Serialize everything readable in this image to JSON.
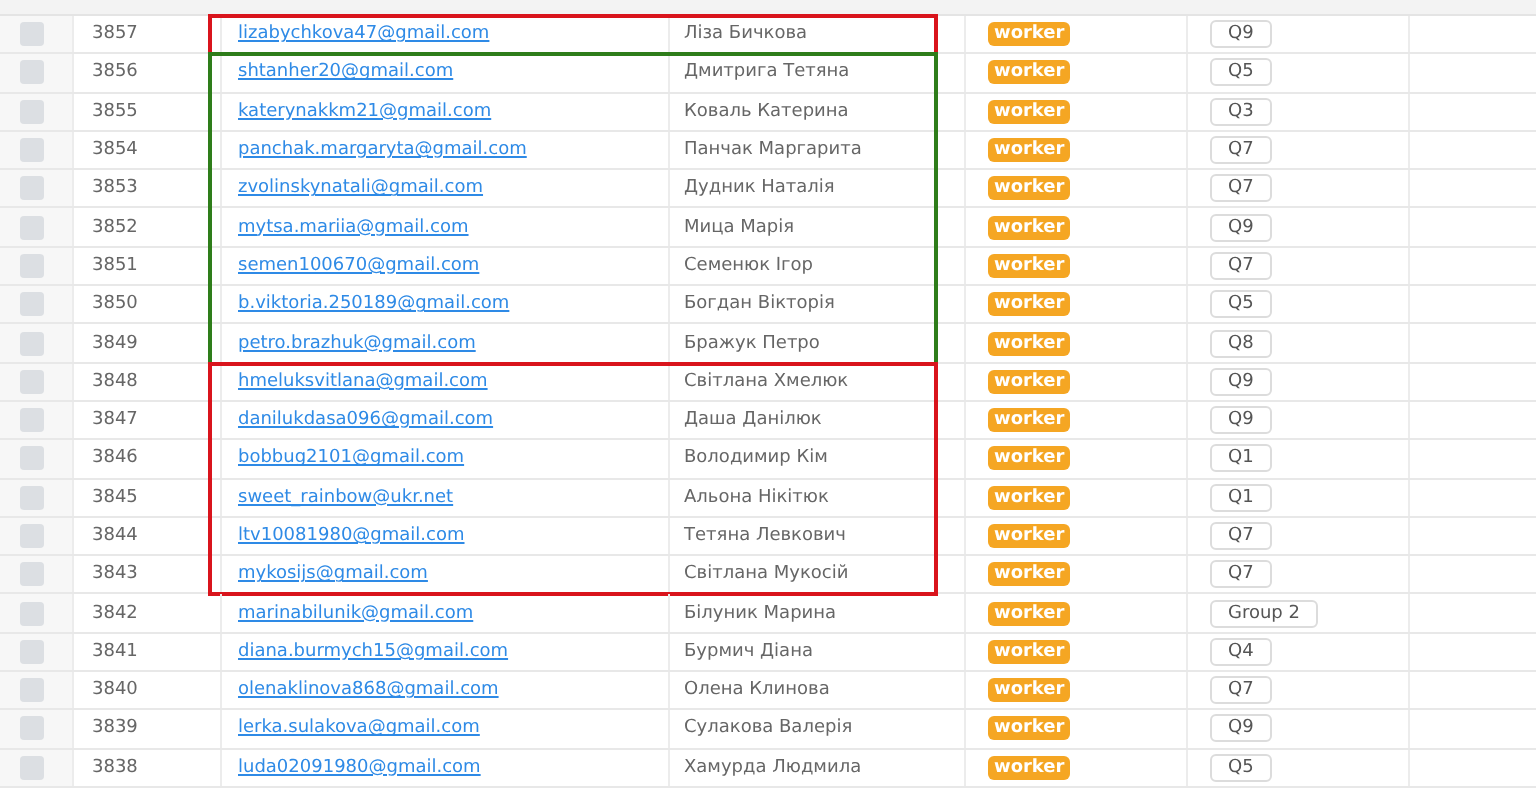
{
  "row_groups": [
    {
      "color": "#d9141c",
      "rows": [
        {
          "checked": false,
          "id": "3857",
          "email": "lizabychkova47@gmail.com",
          "name": "Ліза Бичкова",
          "role": "worker",
          "group": "Q9"
        }
      ]
    },
    {
      "color": "#2e7d1a",
      "rows": [
        {
          "checked": false,
          "id": "3856",
          "email": "shtanher20@gmail.com",
          "name": "Дмитрига Тетяна",
          "role": "worker",
          "group": "Q5"
        },
        {
          "checked": false,
          "id": "3855",
          "email": "katerynakkm21@gmail.com",
          "name": "Коваль Катерина",
          "role": "worker",
          "group": "Q3"
        },
        {
          "checked": false,
          "id": "3854",
          "email": "panchak.margaryta@gmail.com",
          "name": "Панчак Маргарита",
          "role": "worker",
          "group": "Q7"
        },
        {
          "checked": false,
          "id": "3853",
          "email": "zvolinskynatali@gmail.com",
          "name": "Дудник Наталія",
          "role": "worker",
          "group": "Q7"
        },
        {
          "checked": false,
          "id": "3852",
          "email": "mytsa.mariia@gmail.com",
          "name": "Мица Марія",
          "role": "worker",
          "group": "Q9"
        },
        {
          "checked": false,
          "id": "3851",
          "email": "semen100670@gmail.com",
          "name": "Семенюк Ігор",
          "role": "worker",
          "group": "Q7"
        },
        {
          "checked": false,
          "id": "3850",
          "email": "b.viktoria.250189@gmail.com",
          "name": "Богдан Вікторія",
          "role": "worker",
          "group": "Q5"
        },
        {
          "checked": false,
          "id": "3849",
          "email": "petro.brazhuk@gmail.com",
          "name": "Бражук Петро",
          "role": "worker",
          "group": "Q8"
        }
      ]
    },
    {
      "color": "#d9141c",
      "rows": [
        {
          "checked": false,
          "id": "3848",
          "email": "hmeluksvitlana@gmail.com",
          "name": "Світлана Хмелюк",
          "role": "worker",
          "group": "Q9"
        },
        {
          "checked": false,
          "id": "3847",
          "email": "danilukdasa096@gmail.com",
          "name": "Даша Данілюк",
          "role": "worker",
          "group": "Q9"
        },
        {
          "checked": false,
          "id": "3846",
          "email": "bobbug2101@gmail.com",
          "name": "Володимир Кім",
          "role": "worker",
          "group": "Q1"
        },
        {
          "checked": false,
          "id": "3845",
          "email": "sweet_rainbow@ukr.net",
          "name": "Альона Нікітюк",
          "role": "worker",
          "group": "Q1"
        },
        {
          "checked": false,
          "id": "3844",
          "email": "ltv10081980@gmail.com",
          "name": "Тетяна Левкович",
          "role": "worker",
          "group": "Q7"
        },
        {
          "checked": false,
          "id": "3843",
          "email": "mykosijs@gmail.com",
          "name": "Світлана Мукосій",
          "role": "worker",
          "group": "Q7"
        }
      ]
    },
    {
      "rows": [
        {
          "checked": false,
          "id": "3842",
          "email": "marinabilunik@gmail.com",
          "name": "Білуник Марина",
          "role": "worker",
          "group": "Group 2"
        },
        {
          "checked": false,
          "id": "3841",
          "email": "diana.burmych15@gmail.com",
          "name": "Бурмич Діана",
          "role": "worker",
          "group": "Q4"
        },
        {
          "checked": false,
          "id": "3840",
          "email": "olenaklinova868@gmail.com",
          "name": "Олена Клинова",
          "role": "worker",
          "group": "Q7"
        },
        {
          "checked": false,
          "id": "3839",
          "email": "lerka.sulakova@gmail.com",
          "name": "Сулакова Валерія",
          "role": "worker",
          "group": "Q9"
        },
        {
          "checked": false,
          "id": "3838",
          "email": "luda02091980@gmail.com",
          "name": "Хамурда Людмила",
          "role": "worker",
          "group": "Q5"
        }
      ]
    }
  ]
}
